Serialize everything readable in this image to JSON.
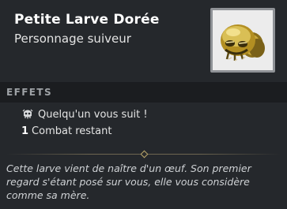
{
  "title": "Petite Larve Dorée",
  "subtitle": "Personnage suiveur",
  "portrait_icon": "golden-larva",
  "section": {
    "title": "EFFETS"
  },
  "effects": [
    {
      "icon": "follower-icon",
      "text": "Quelqu'un vous suit !"
    },
    {
      "count": "1",
      "text": "Combat restant"
    }
  ],
  "description": "Cette larve vient de naître d'un œuf. Son premier regard s'étant posé sur vous, elle vous considère comme sa mère.",
  "colors": {
    "background": "#25282c",
    "section_bar": "#1b1d20",
    "portrait_border": "#8f9296",
    "larva_gold": "#b89a2a",
    "divider_accent": "#b9a66a"
  }
}
